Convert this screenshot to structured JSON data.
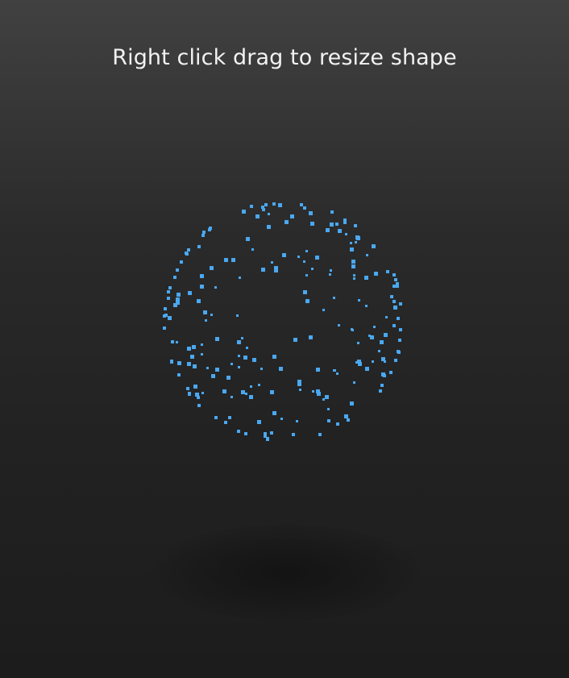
{
  "hint_text": "Right click drag to resize shape",
  "colors": {
    "particle": "#4aa8f0"
  },
  "shape": {
    "type": "particle-sphere",
    "particle_count": 220
  }
}
